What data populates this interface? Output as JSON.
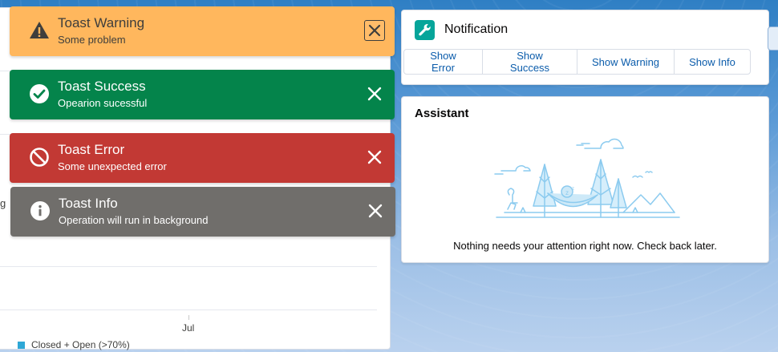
{
  "report": {
    "fragment_label": "g",
    "axis_label": "Jul",
    "legend_label": "Closed + Open (>70%)",
    "legend_color": "#2ea7d6"
  },
  "toasts": [
    {
      "variant": "warning",
      "title": "Toast Warning",
      "message": "Some problem",
      "color": "#ffb75d",
      "icon": "warning-icon"
    },
    {
      "variant": "success",
      "title": "Toast Success",
      "message": "Opearion sucessful",
      "color": "#04844b",
      "icon": "success-icon"
    },
    {
      "variant": "error",
      "title": "Toast Error",
      "message": "Some unexpected error",
      "color": "#c23934",
      "icon": "error-icon"
    },
    {
      "variant": "info",
      "title": "Toast Info",
      "message": "Operation will run in background",
      "color": "#706e6b",
      "icon": "info-icon"
    }
  ],
  "notification_card": {
    "title": "Notification",
    "icon": "wrench-icon",
    "icon_color": "#06a59a",
    "buttons": [
      "Show Error",
      "Show Success",
      "Show Warning",
      "Show Info"
    ]
  },
  "assistant_card": {
    "title": "Assistant",
    "empty_message": "Nothing needs your attention right now. Check back later."
  }
}
